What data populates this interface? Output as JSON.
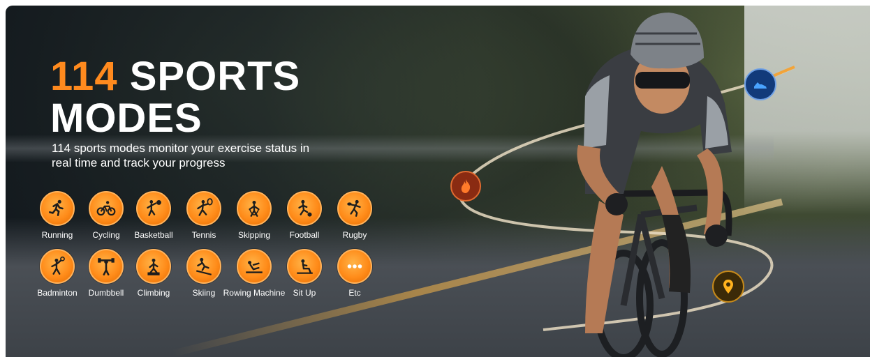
{
  "headline": {
    "number": "114",
    "rest_line1": "SPORTS",
    "line2": "MODES"
  },
  "subtitle": "114 sports modes monitor your exercise status in real time and track your progress",
  "colors": {
    "accent": "#ff8a1e",
    "icon_fill": "#ff8c1a",
    "text": "#ffffff"
  },
  "modes": [
    {
      "label": "Running",
      "icon": "running-icon"
    },
    {
      "label": "Cycling",
      "icon": "cycling-icon"
    },
    {
      "label": "Basketball",
      "icon": "basketball-icon"
    },
    {
      "label": "Tennis",
      "icon": "tennis-icon"
    },
    {
      "label": "Skipping",
      "icon": "skipping-icon"
    },
    {
      "label": "Football",
      "icon": "football-icon"
    },
    {
      "label": "Rugby",
      "icon": "rugby-icon"
    },
    {
      "label": "Badminton",
      "icon": "badminton-icon"
    },
    {
      "label": "Dumbbell",
      "icon": "dumbbell-icon"
    },
    {
      "label": "Climbing",
      "icon": "climbing-icon"
    },
    {
      "label": "Skiing",
      "icon": "skiing-icon"
    },
    {
      "label": "Rowing Machine",
      "icon": "rowing-machine-icon"
    },
    {
      "label": "Sit Up",
      "icon": "sit-up-icon"
    },
    {
      "label": "Etc",
      "icon": "more-dots-icon"
    }
  ],
  "trail_icons": [
    "shoe-icon",
    "flame-icon",
    "location-pin-icon"
  ]
}
